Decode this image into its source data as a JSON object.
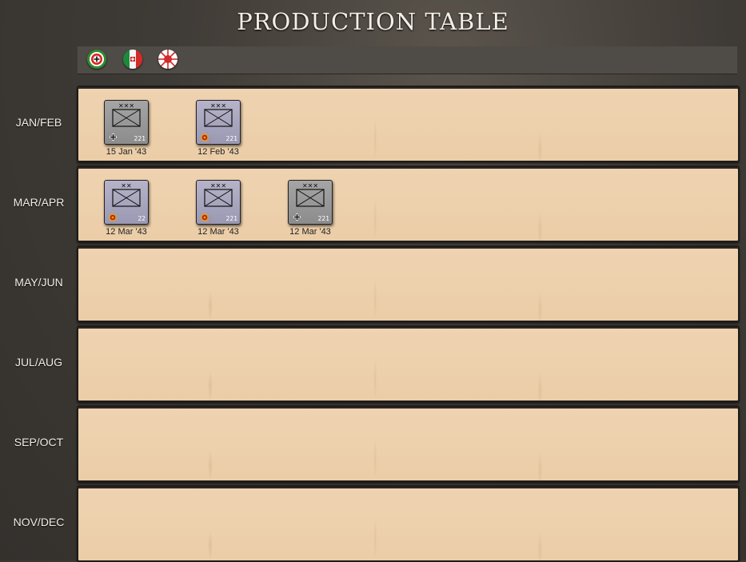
{
  "title": "PRODUCTION TABLE",
  "flags": [
    {
      "name": "germany-roundel-icon"
    },
    {
      "name": "italy-roundel-icon"
    },
    {
      "name": "japan-roundel-icon"
    }
  ],
  "rows": [
    {
      "label": "JAN/FEB",
      "units": [
        {
          "nation": "ger",
          "size": "xxx",
          "strength": "221",
          "date": "15 Jan '43"
        },
        {
          "nation": "ita",
          "size": "xxx",
          "strength": "221",
          "date": "12 Feb '43"
        }
      ]
    },
    {
      "label": "MAR/APR",
      "units": [
        {
          "nation": "ita",
          "size": "xx",
          "strength": "22",
          "date": "12 Mar '43"
        },
        {
          "nation": "ita",
          "size": "xxx",
          "strength": "221",
          "date": "12 Mar '43"
        },
        {
          "nation": "ger",
          "size": "xxx",
          "strength": "221",
          "date": "12 Mar '43"
        }
      ]
    },
    {
      "label": "MAY/JUN",
      "units": []
    },
    {
      "label": "JUL/AUG",
      "units": []
    },
    {
      "label": "SEP/OCT",
      "units": []
    },
    {
      "label": "NOV/DEC",
      "units": []
    }
  ],
  "colors": {
    "panel": "#ebcda8",
    "german_counter": "#999999",
    "italian_counter": "#a9a6c0"
  }
}
